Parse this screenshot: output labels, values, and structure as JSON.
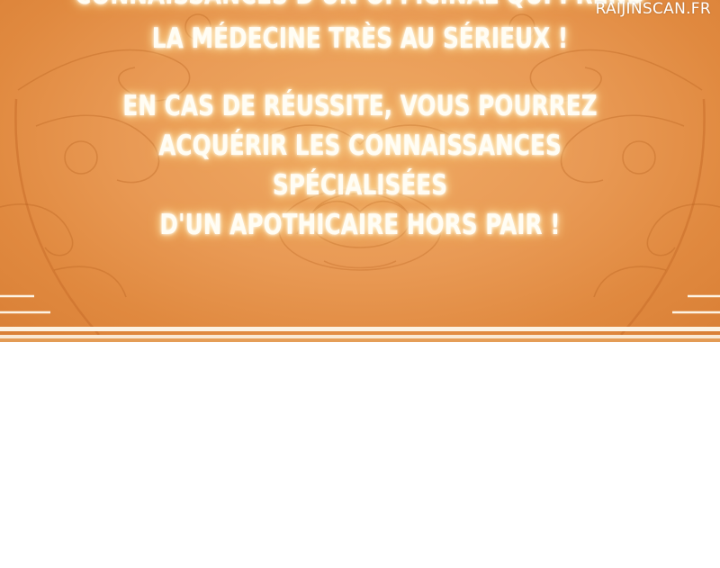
{
  "panel": {
    "watermark": "RAIJINSCAN.FR",
    "paragraph_1": {
      "line_1": "CONNAISSANCES D'UN OFFICINAL QUI PREND",
      "line_2": "LA MÉDECINE TRÈS AU SÉRIEUX !"
    },
    "paragraph_2": {
      "line_1": "EN CAS DE RÉUSSITE, VOUS POURREZ",
      "line_2": "ACQUÉRIR LES CONNAISSANCES SPÉCIALISÉES",
      "line_3": "D'UN APOTHICAIRE HORS PAIR !"
    }
  },
  "colors": {
    "panel_center": "#efaa64",
    "panel_edge": "#d97f35",
    "text": "#fffdf4",
    "glow": "#ffcf7a",
    "border_lines": "#fdf3e3"
  }
}
